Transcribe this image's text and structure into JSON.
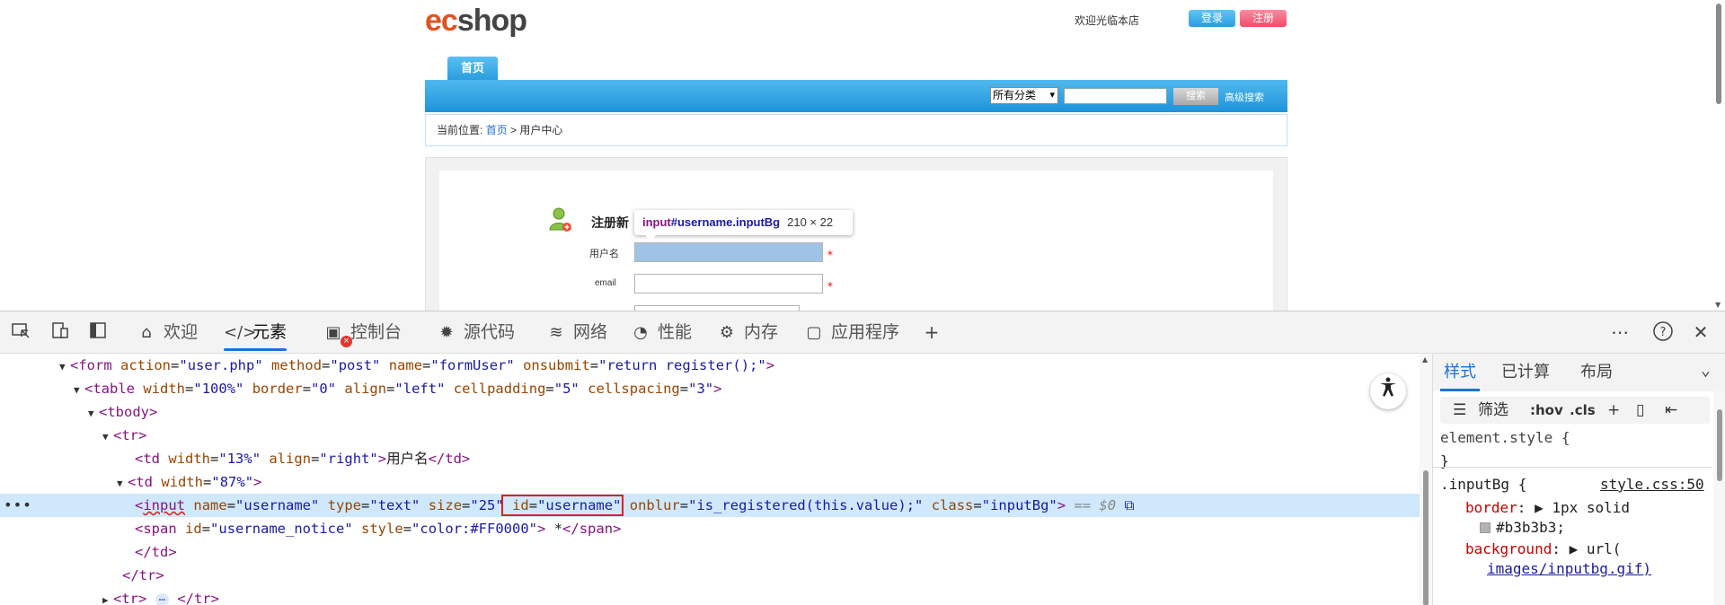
{
  "page": {
    "logo_ec": "ec",
    "logo_shop": "shop",
    "welcome": "欢迎光临本店",
    "login": "登录",
    "register": "注册",
    "tab_home": "首页",
    "category_select": "所有分类",
    "search_button": "搜索",
    "advanced_search": "高级搜索",
    "breadcrumb_prefix": "当前位置:",
    "breadcrumb_home": "首页",
    "breadcrumb_sep": ">",
    "breadcrumb_current": "用户中心",
    "reg_title": "注册新",
    "label_username": "用户名",
    "label_email": "email",
    "required_mark": "*",
    "tooltip_tag": "input",
    "tooltip_selector": "#username.inputBg",
    "tooltip_dims": "210 × 22"
  },
  "devtools": {
    "tabs": [
      {
        "label": "欢迎",
        "icon": "home-icon"
      },
      {
        "label": "元素",
        "icon": "code-icon"
      },
      {
        "label": "控制台",
        "icon": "console-icon"
      },
      {
        "label": "源代码",
        "icon": "bug-icon"
      },
      {
        "label": "网络",
        "icon": "wifi-icon"
      },
      {
        "label": "性能",
        "icon": "gauge-icon"
      },
      {
        "label": "内存",
        "icon": "chip-icon"
      },
      {
        "label": "应用程序",
        "icon": "app-icon"
      }
    ],
    "error_badge": "×",
    "dom_lines": [
      {
        "kind": "open",
        "tag": "form",
        "attrs": [
          [
            "action",
            "user.php"
          ],
          [
            "method",
            "post"
          ],
          [
            "name",
            "formUser"
          ],
          [
            "onsubmit",
            "return register();"
          ]
        ]
      },
      {
        "kind": "open",
        "tag": "table",
        "attrs": [
          [
            "width",
            "100%"
          ],
          [
            "border",
            "0"
          ],
          [
            "align",
            "left"
          ],
          [
            "cellpadding",
            "5"
          ],
          [
            "cellspacing",
            "3"
          ]
        ]
      },
      {
        "kind": "open",
        "tag": "tbody",
        "attrs": []
      },
      {
        "kind": "open",
        "tag": "tr",
        "attrs": []
      },
      {
        "kind": "text",
        "tag": "td",
        "attrs": [
          [
            "width",
            "13%"
          ],
          [
            "align",
            "right"
          ]
        ],
        "text": "用户名"
      },
      {
        "kind": "open",
        "tag": "td",
        "attrs": [
          [
            "width",
            "87%"
          ]
        ]
      },
      {
        "kind": "input",
        "tag": "input",
        "attrs": [
          [
            "name",
            "username"
          ],
          [
            "type",
            "text"
          ],
          [
            "size",
            "25"
          ],
          [
            "id",
            "username"
          ],
          [
            "onblur",
            "is_registered(this.value);"
          ],
          [
            "class",
            "inputBg"
          ]
        ],
        "suffix": "== $0"
      },
      {
        "kind": "text",
        "tag": "span",
        "attrs": [
          [
            "id",
            "username_notice"
          ],
          [
            "style",
            "color:#FF0000"
          ]
        ],
        "text": " *"
      },
      {
        "kind": "close",
        "tag": "td"
      },
      {
        "kind": "close",
        "tag": "tr"
      },
      {
        "kind": "collapsed",
        "tag": "tr",
        "pill": "⋯"
      }
    ],
    "styles_tabs": [
      "样式",
      "已计算",
      "布局"
    ],
    "filter_label": "筛选",
    "hov": ":hov",
    "cls": ".cls",
    "element_style": "element.style {",
    "close_brace": "}",
    "rule_selector": ".inputBg {",
    "rule_source": "style.css:50",
    "prop_border": "border",
    "val_border": "1px solid",
    "val_border_color": "#b3b3b3;",
    "prop_background": "background",
    "val_background": "url(",
    "val_background_path": "images/inputbg.gif)"
  }
}
